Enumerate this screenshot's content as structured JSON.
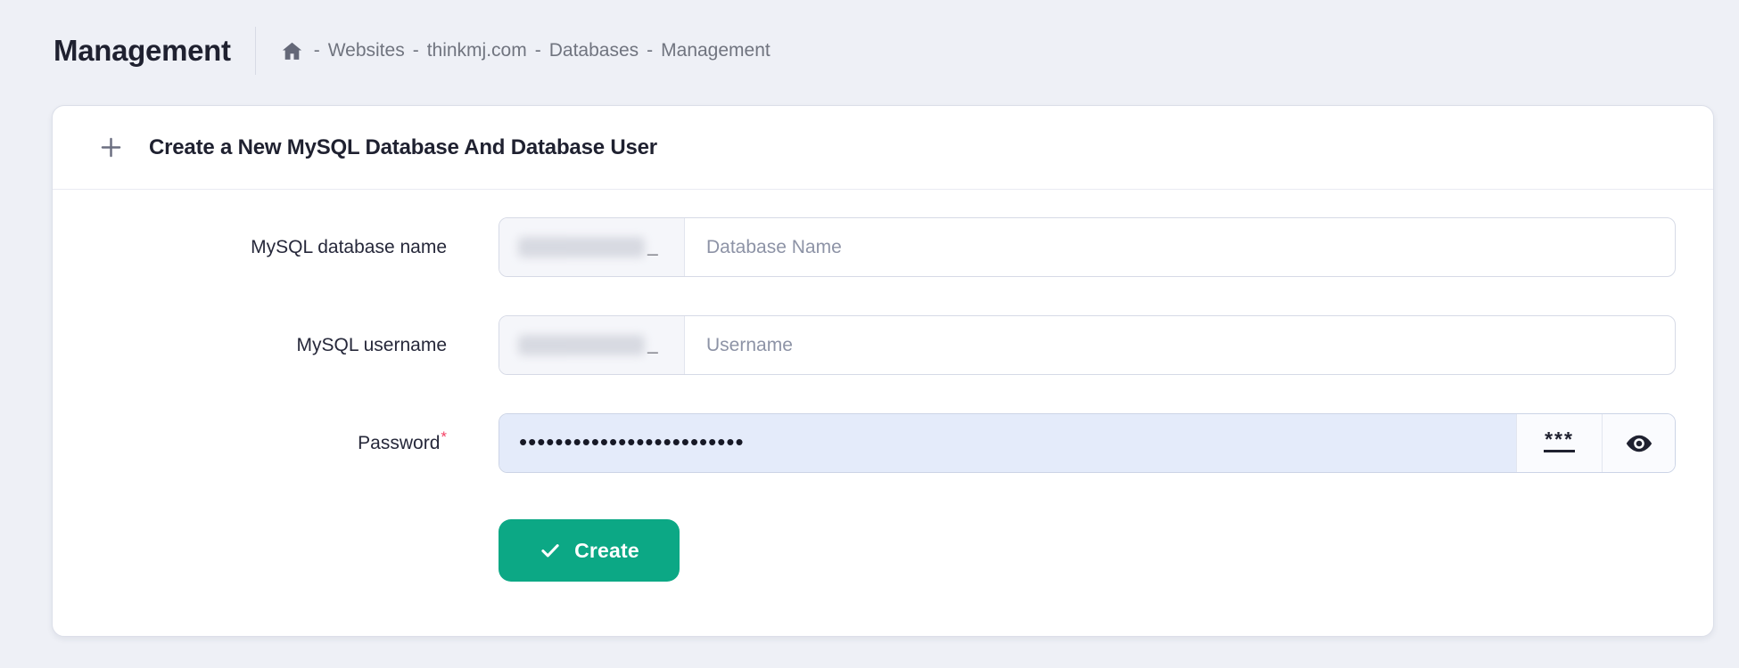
{
  "page": {
    "title": "Management"
  },
  "breadcrumb": {
    "separator": "-",
    "items": [
      "Websites",
      "thinkmj.com",
      "Databases",
      "Management"
    ]
  },
  "card": {
    "title": "Create a New MySQL Database And Database User"
  },
  "form": {
    "rows": [
      {
        "label": "MySQL database name",
        "prefix_redacted": true,
        "prefix_suffix": "_",
        "value": "",
        "placeholder": "Database Name"
      },
      {
        "label": "MySQL username",
        "prefix_redacted": true,
        "prefix_suffix": "_",
        "value": "",
        "placeholder": "Username"
      }
    ],
    "password": {
      "label": "Password",
      "required_marker": "*",
      "masked_value": "•••••••••••••••••••••••••",
      "generate_button_label": "***"
    },
    "create_button_label": "Create"
  },
  "icons": {
    "home": "house-glyph",
    "plus": "+",
    "check": "✓",
    "eye": "show-password-eye",
    "generate_password": "*** underlined"
  },
  "colors": {
    "page_background": "#eef0f6",
    "card_background": "#ffffff",
    "accent_green": "#0ca885",
    "password_field_background": "#e4ebfa",
    "required_marker": "#f43f63",
    "muted_text": "#70747f"
  }
}
